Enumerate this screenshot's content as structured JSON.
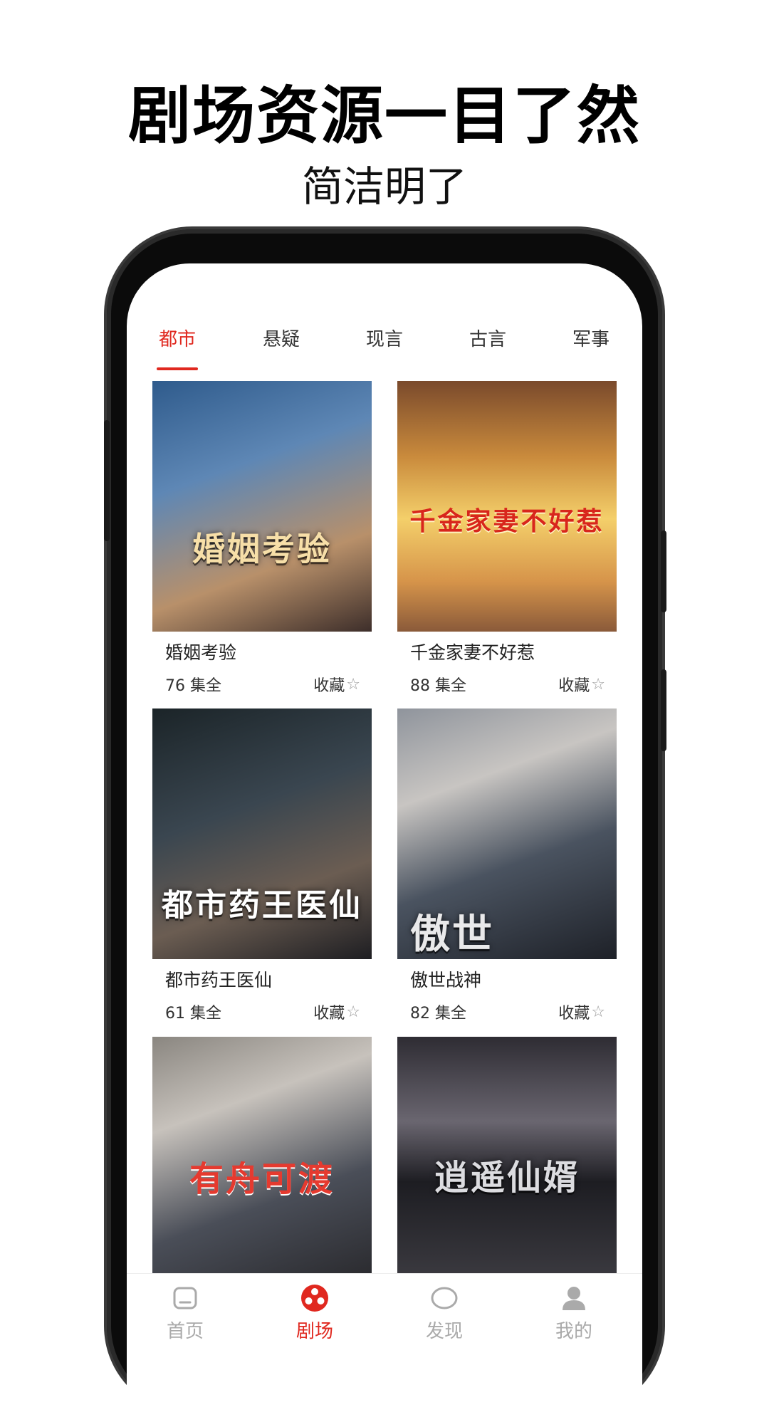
{
  "promo": {
    "headline": "剧场资源一目了然",
    "subline": "简洁明了"
  },
  "tabs": [
    {
      "label": "都市",
      "active": true
    },
    {
      "label": "悬疑",
      "active": false
    },
    {
      "label": "现言",
      "active": false
    },
    {
      "label": "古言",
      "active": false
    },
    {
      "label": "军事",
      "active": false
    }
  ],
  "dramas": [
    {
      "poster_text": "婚姻考验",
      "title": "婚姻考验",
      "episodes": "76 集全",
      "fav_label": "收藏",
      "colors": [
        "#3b5f8d",
        "#c9a46b"
      ]
    },
    {
      "poster_text": "千金家妻不好惹",
      "title": "千金家妻不好惹",
      "episodes": "88 集全",
      "fav_label": "收藏",
      "colors": [
        "#b67a3b",
        "#f2c35a"
      ]
    },
    {
      "poster_text": "都市药王医仙",
      "title": "都市药王医仙",
      "episodes": "61 集全",
      "fav_label": "收藏",
      "colors": [
        "#1f2a2e",
        "#55606a"
      ]
    },
    {
      "poster_text": "傲世",
      "title": "傲世战神",
      "episodes": "82 集全",
      "fav_label": "收藏",
      "colors": [
        "#7b8491",
        "#2c3039"
      ]
    },
    {
      "poster_text": "有舟可渡",
      "title": "",
      "episodes": "",
      "fav_label": "",
      "colors": [
        "#6d6a6f",
        "#b7b3ae"
      ]
    },
    {
      "poster_text": "逍遥仙婿",
      "title": "",
      "episodes": "",
      "fav_label": "",
      "colors": [
        "#1c1c22",
        "#5a5860"
      ]
    }
  ],
  "bottom_nav": [
    {
      "label": "首页",
      "icon": "home-icon",
      "active": false
    },
    {
      "label": "剧场",
      "icon": "theater-reel-icon",
      "active": true
    },
    {
      "label": "发现",
      "icon": "discover-icon",
      "active": false
    },
    {
      "label": "我的",
      "icon": "profile-icon",
      "active": false
    }
  ],
  "colors": {
    "accent": "#e0281f",
    "inactive": "#aaaaaa"
  }
}
